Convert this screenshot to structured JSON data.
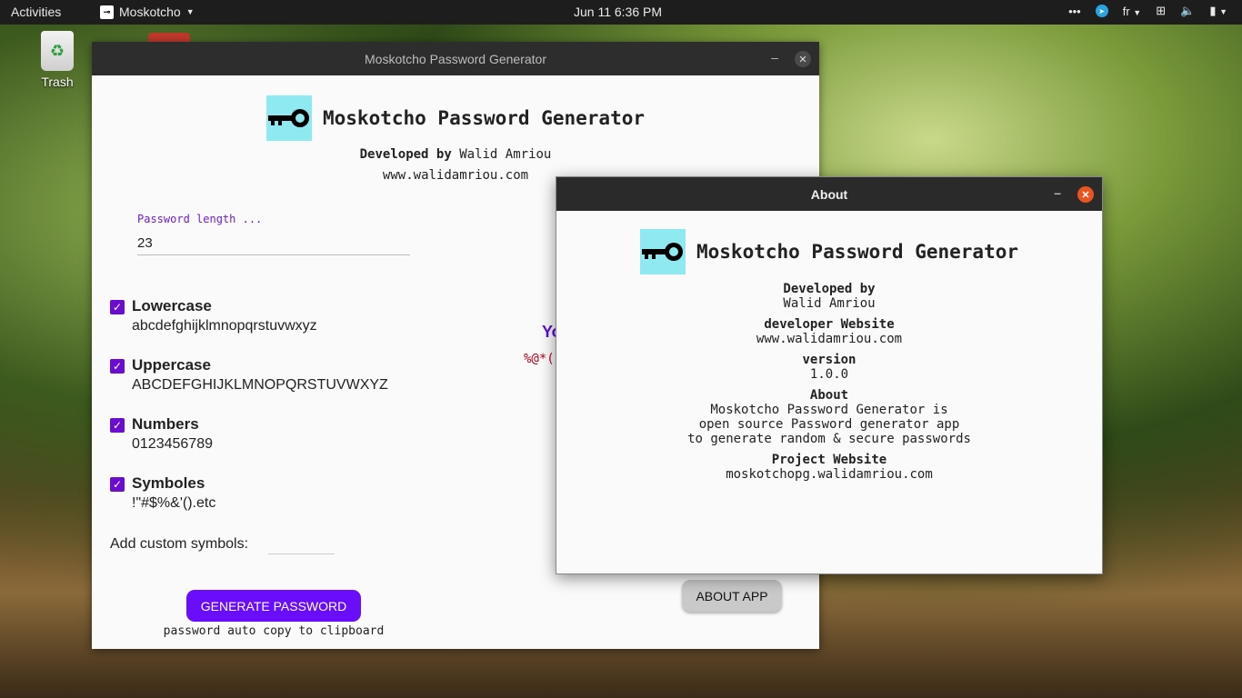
{
  "topbar": {
    "activities": "Activities",
    "app_name": "Moskotcho",
    "clock": "Jun 11   6:36 PM",
    "more": "•••",
    "lang": "fr"
  },
  "desktop": {
    "trash_label": "Trash"
  },
  "main_window": {
    "title": "Moskotcho Password Generator",
    "app_title": "Moskotcho Password Generator",
    "dev_prefix": "Developed by",
    "dev_name": "Walid Amriou",
    "website": "www.walidamriou.com",
    "length_label": "Password length ...",
    "length_value": "23",
    "options": [
      {
        "label": "Lowercase",
        "chars": "abcdefghijklmnopqrstuvwxyz",
        "checked": true
      },
      {
        "label": "Uppercase",
        "chars": "ABCDEFGHIJKLMNOPQRSTUVWXYZ",
        "checked": true
      },
      {
        "label": "Numbers",
        "chars": "0123456789",
        "checked": true
      },
      {
        "label": "Symboles",
        "chars": "!\"#$%&'().etc",
        "checked": true
      }
    ],
    "custom_label": "Add custom symbols:",
    "custom_value": "",
    "result_label_partial": "Yo",
    "result_password_partial": "%@*(",
    "generate_button": "GENERATE PASSWORD",
    "generate_hint": "password auto copy to clipboard",
    "about_button": "ABOUT APP",
    "accent_color": "#6a0dfb"
  },
  "about_window": {
    "title": "About",
    "app_title": "Moskotcho Password Generator",
    "developed_by_heading": "Developed by",
    "developed_by_value": "Walid Amriou",
    "website_heading": "developer Website",
    "website_value": "www.walidamriou.com",
    "version_heading": "version",
    "version_value": "1.0.0",
    "about_heading": "About",
    "about_lines": [
      "Moskotcho Password Generator is",
      "open source Password generator app",
      "to generate random & secure passwords"
    ],
    "project_heading": "Project Website",
    "project_value": "moskotchopg.walidamriou.com",
    "close_color": "#e95420"
  },
  "icons": [
    "trash-icon",
    "key-logo-icon",
    "close-icon",
    "minimize-icon",
    "checkbox-checked-icon",
    "telegram-icon",
    "network-icon",
    "volume-icon",
    "battery-icon"
  ]
}
